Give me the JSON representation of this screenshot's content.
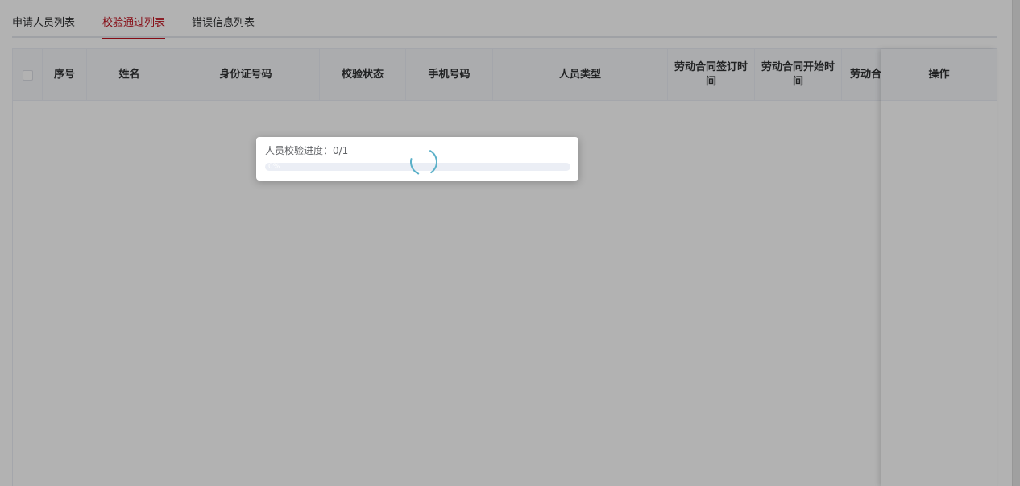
{
  "tabs": [
    {
      "label": "申请人员列表",
      "active": false
    },
    {
      "label": "校验通过列表",
      "active": true
    },
    {
      "label": "错误信息列表",
      "active": false
    }
  ],
  "table": {
    "columns": {
      "index": "序号",
      "name": "姓名",
      "id_number": "身份证号码",
      "check_status": "校验状态",
      "phone": "手机号码",
      "person_type": "人员类型",
      "contract_sign_time": "劳动合同签订时间",
      "contract_start_time": "劳动合同开始时间",
      "contract_end_partial": "劳动合",
      "actions": "操作"
    },
    "rows": []
  },
  "progress": {
    "label": "人员校验进度：0/1",
    "percent": 0,
    "percent_text": "0%"
  },
  "colors": {
    "accent": "#c0121f",
    "spinner": "#5ab0c8",
    "header_bg": "#f5f7fa"
  },
  "icons": {
    "spinner": "loading-spinner-icon",
    "checkbox": "select-all-checkbox"
  }
}
